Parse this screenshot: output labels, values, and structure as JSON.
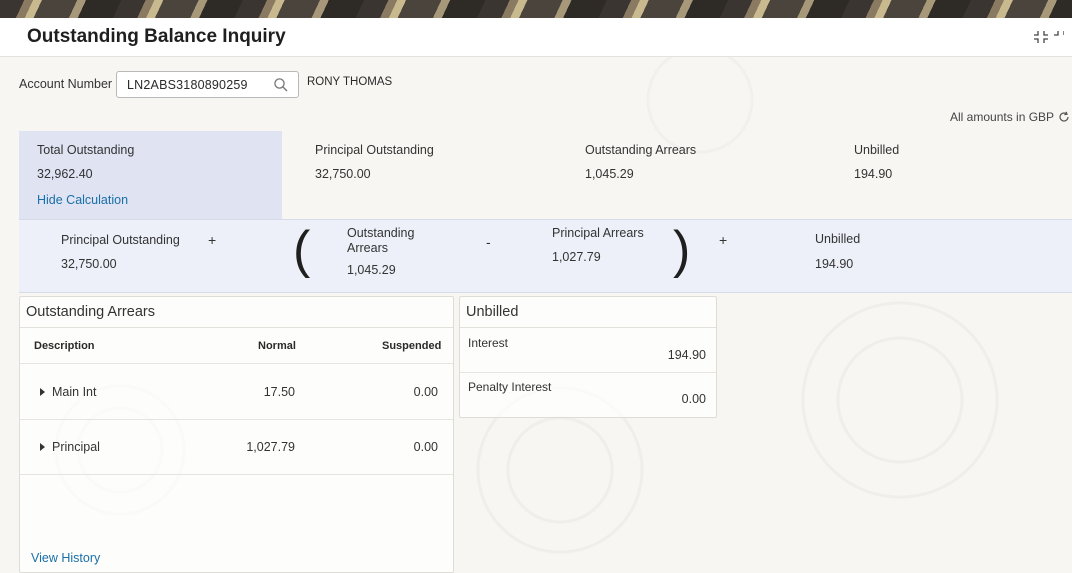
{
  "page": {
    "title": "Outstanding Balance Inquiry",
    "amounts_note": "All amounts in GBP"
  },
  "account": {
    "label": "Account Number",
    "number": "LN2ABS3180890259",
    "customer_name": "RONY THOMAS"
  },
  "summary": [
    {
      "label": "Total Outstanding",
      "value": "32,962.40"
    },
    {
      "label": "Principal Outstanding",
      "value": "32,750.00"
    },
    {
      "label": "Outstanding Arrears",
      "value": "1,045.29"
    },
    {
      "label": "Unbilled",
      "value": "194.90"
    }
  ],
  "hide_calculation": "Hide Calculation",
  "calculation": {
    "principal_outstanding": {
      "label": "Principal Outstanding",
      "value": "32,750.00"
    },
    "plus_1": "+",
    "open_paren": "(",
    "outstanding_arrears": {
      "label": "Outstanding Arrears",
      "value": "1,045.29"
    },
    "minus": "-",
    "principal_arrears": {
      "label": "Principal Arrears",
      "value": "1,027.79"
    },
    "close_paren": ")",
    "plus_2": "+",
    "unbilled": {
      "label": "Unbilled",
      "value": "194.90"
    }
  },
  "outstanding_arrears": {
    "title": "Outstanding Arrears",
    "columns": [
      "Description",
      "Normal",
      "Suspended"
    ],
    "rows": [
      {
        "description": "Main Int",
        "normal": "17.50",
        "suspended": "0.00"
      },
      {
        "description": "Principal",
        "normal": "1,027.79",
        "suspended": "0.00"
      }
    ],
    "view_history": "View History"
  },
  "unbilled": {
    "title": "Unbilled",
    "rows": [
      {
        "label": "Interest",
        "value": "194.90"
      },
      {
        "label": "Penalty Interest",
        "value": "0.00"
      }
    ]
  },
  "icons": {
    "search": "search-icon",
    "collapse": "collapse-icon",
    "refresh": "refresh-icon",
    "expand_row": "caret-right-icon"
  }
}
